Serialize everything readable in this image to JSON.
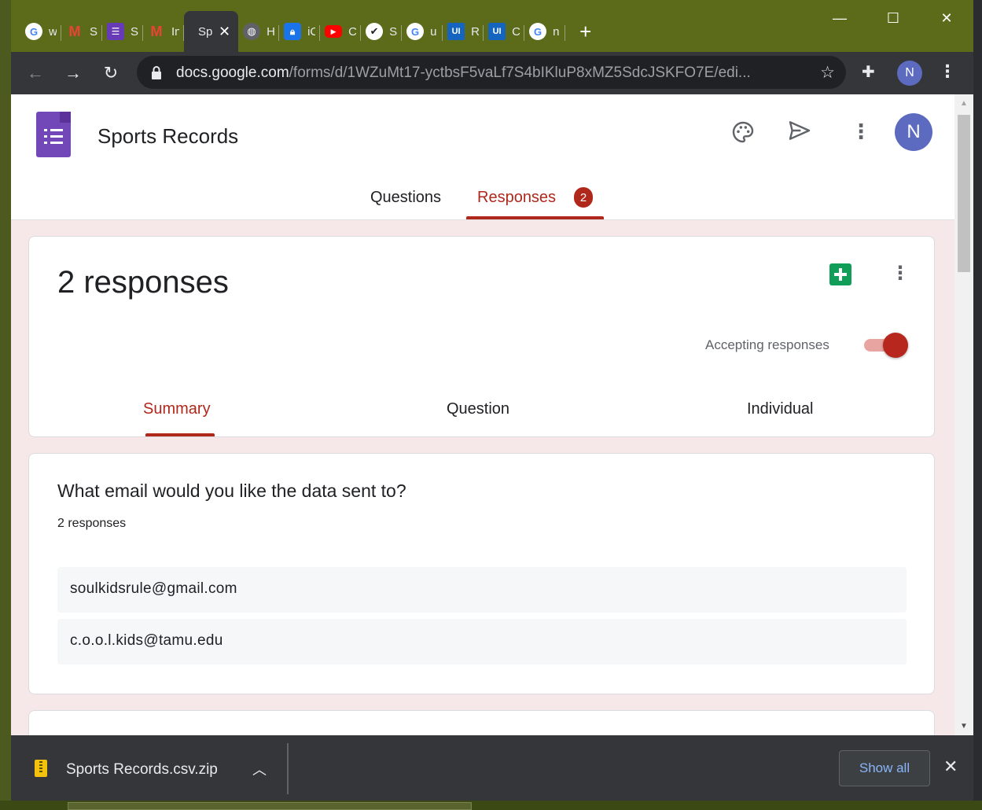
{
  "browser": {
    "tabs": [
      {
        "label": "w",
        "icon": "google-icon",
        "color": "#ffffff"
      },
      {
        "label": "S",
        "icon": "gmail-icon",
        "color": "#ffffff"
      },
      {
        "label": "S",
        "icon": "forms-icon",
        "color": "#673ab7"
      },
      {
        "label": "In",
        "icon": "gmail-icon",
        "color": "#ffffff"
      },
      {
        "label": "Sp",
        "icon": "",
        "color": "",
        "active": true
      },
      {
        "label": "H",
        "icon": "globe-icon",
        "color": "#5f6368"
      },
      {
        "label": "iC",
        "icon": "lock-icon",
        "color": "#1a73e8"
      },
      {
        "label": "C",
        "icon": "youtube-icon",
        "color": "#ff0000"
      },
      {
        "label": "S",
        "icon": "check-icon",
        "color": "#ffffff"
      },
      {
        "label": "u",
        "icon": "google-icon",
        "color": "#ffffff"
      },
      {
        "label": "R",
        "icon": "ui-icon",
        "color": "#1565c0"
      },
      {
        "label": "C",
        "icon": "ui-icon",
        "color": "#1565c0"
      },
      {
        "label": "n",
        "icon": "google-icon",
        "color": "#ffffff"
      }
    ],
    "url_host": "docs.google.com",
    "url_path": "/forms/d/1WZuMt17-yctbsF5vaLf7S4bIKluP8xMZ5SdcJSKFO7E/edi...",
    "profile_initial": "N"
  },
  "form": {
    "title": "Sports Records",
    "avatar_initial": "N",
    "tabs": {
      "questions": "Questions",
      "responses": "Responses",
      "responses_count": "2"
    },
    "summary_card": {
      "count_label": "2 responses",
      "accepting_label": "Accepting responses",
      "accepting": true,
      "subtabs": {
        "summary": "Summary",
        "question": "Question",
        "individual": "Individual"
      }
    },
    "question_card": {
      "question": "What email would you like the data sent to?",
      "response_count": "2 responses",
      "responses": [
        "soulkidsrule@gmail.com",
        "c.o.o.l.kids@tamu.edu"
      ]
    }
  },
  "download_shelf": {
    "filename": "Sports Records.csv.zip",
    "show_all_label": "Show all"
  },
  "colors": {
    "accent": "#b0271b",
    "titlebar": "#5c6b1a",
    "toolbar": "#35363a",
    "forms_purple": "#7248b9",
    "sheets_green": "#0f9d58"
  }
}
